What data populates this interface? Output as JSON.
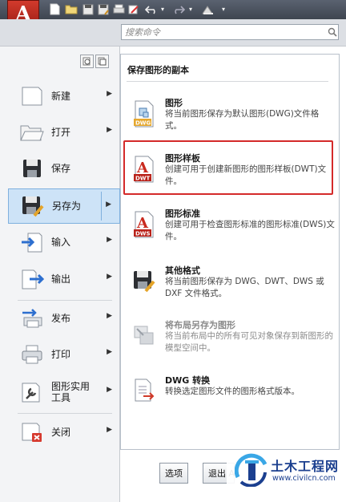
{
  "app": {
    "logo_letter": "A"
  },
  "search": {
    "placeholder": "搜索命令"
  },
  "menu": [
    {
      "id": "new",
      "label": "新建",
      "icon": "new-file-icon",
      "has_submenu": true
    },
    {
      "id": "open",
      "label": "打开",
      "icon": "open-folder-icon",
      "has_submenu": true
    },
    {
      "id": "save",
      "label": "保存",
      "icon": "save-icon",
      "has_submenu": false
    },
    {
      "id": "saveas",
      "label": "另存为",
      "icon": "save-as-icon",
      "has_submenu": true,
      "active": true
    },
    {
      "id": "import",
      "label": "输入",
      "icon": "import-icon",
      "has_submenu": true
    },
    {
      "id": "export",
      "label": "输出",
      "icon": "export-icon",
      "has_submenu": true
    },
    {
      "id": "publish",
      "label": "发布",
      "icon": "publish-icon",
      "has_submenu": true
    },
    {
      "id": "print",
      "label": "打印",
      "icon": "printer-icon",
      "has_submenu": true
    },
    {
      "id": "utilities",
      "label": "图形实用工具",
      "icon": "wrench-icon",
      "has_submenu": true
    },
    {
      "id": "close",
      "label": "关闭",
      "icon": "close-document-icon",
      "has_submenu": true
    }
  ],
  "panel": {
    "title": "保存图形的副本",
    "options": [
      {
        "title": "图形",
        "desc": "将当前图形保存为默认图形(DWG)文件格式。",
        "icon": "dwg-file-icon",
        "badge": "DWG"
      },
      {
        "title": "图形样板",
        "desc": "创建可用于创建新图形的图形样板(DWT)文件。",
        "icon": "dwt-file-icon",
        "badge": "DWT"
      },
      {
        "title": "图形标准",
        "desc": "创建可用于检查图形标准的图形标准(DWS)文件。",
        "icon": "dws-file-icon",
        "badge": "DWS"
      },
      {
        "title": "其他格式",
        "desc": "将当前图形保存为 DWG、DWT、DWS 或 DXF 文件格式。",
        "icon": "save-other-formats-icon"
      },
      {
        "title": "将布局另存为图形",
        "desc": "将当前布局中的所有可见对象保存到新图形的模型空间中。",
        "icon": "layout-to-drawing-icon",
        "disabled": true
      },
      {
        "title": "DWG 转换",
        "desc": "转换选定图形文件的图形格式版本。",
        "icon": "dwg-convert-icon"
      }
    ]
  },
  "bottom": {
    "options_label": "选项",
    "exit_label": "退出 A"
  },
  "watermark": {
    "name": "土木工程网",
    "url": "www.civilcn.com"
  },
  "colors": {
    "accent_red": "#d42a2a",
    "active_bg": "#cde3f7",
    "brand_blue": "#1b3f8f"
  }
}
